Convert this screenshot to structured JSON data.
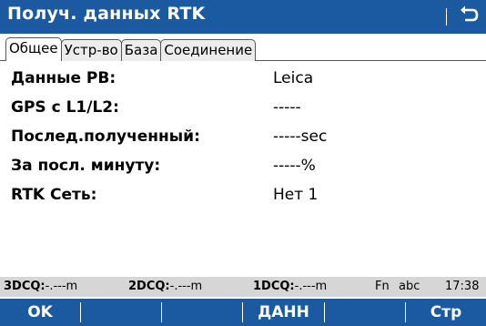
{
  "window": {
    "title": "Получ. данных RTK",
    "back_icon": "back-arrow-icon"
  },
  "tabs": [
    {
      "label": "Общее",
      "active": true
    },
    {
      "label": "Устр-во",
      "active": false
    },
    {
      "label": "База",
      "active": false
    },
    {
      "label": "Соединение",
      "active": false
    }
  ],
  "fields": [
    {
      "label": "Данные РВ:",
      "value": "Leica"
    },
    {
      "label": "GPS с L1/L2:",
      "value": "-----"
    },
    {
      "label": "Послед.полученный:",
      "value": "-----sec"
    },
    {
      "label": "За посл. минуту:",
      "value": "-----%"
    },
    {
      "label": "RTK Сеть:",
      "value": "Нет 1"
    }
  ],
  "status_bar": {
    "dcq3_label": "3DCQ:",
    "dcq3_value": "-.---m",
    "dcq2_label": "2DCQ:",
    "dcq2_value": "-.---m",
    "dcq1_label": "1DCQ:",
    "dcq1_value": "-.---m",
    "fn": "Fn",
    "input_mode": "abc",
    "time": "17:38"
  },
  "softkeys": {
    "f1": "OK",
    "f2": "",
    "f3": "",
    "f4": "ДАНН",
    "f5": "",
    "f6": "Стр"
  },
  "colors": {
    "accent": "#1b5aa0",
    "status_bg": "#d6d6d6"
  }
}
